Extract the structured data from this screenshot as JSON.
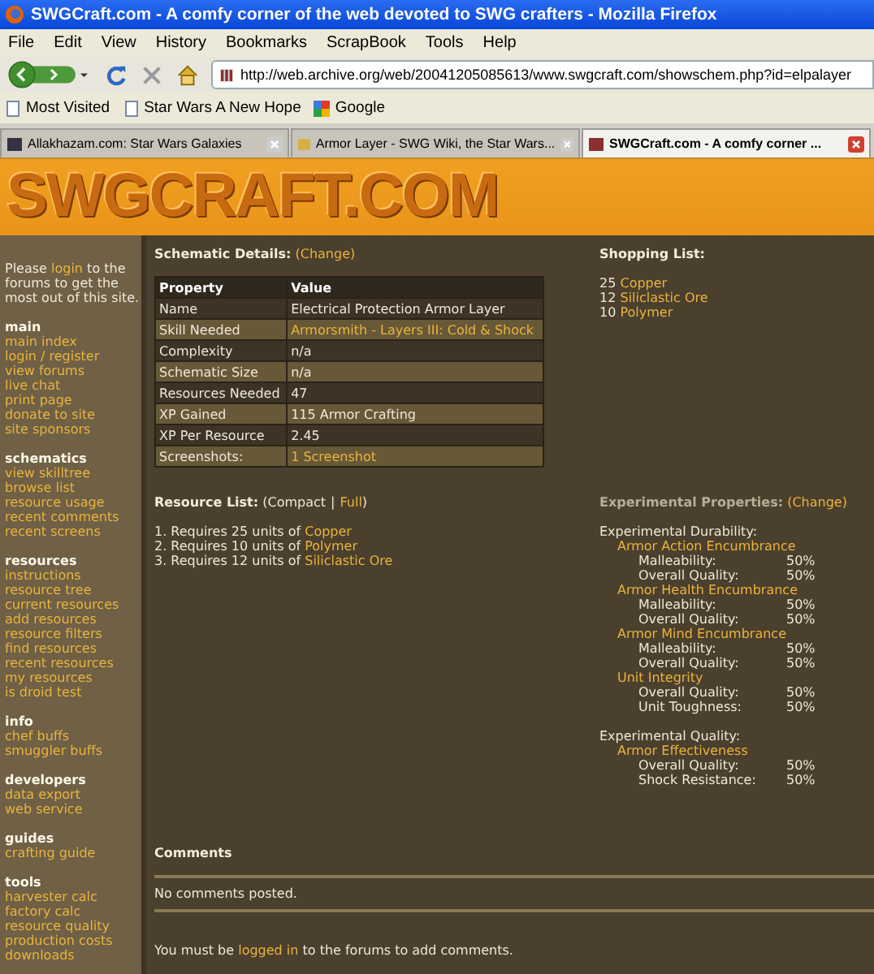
{
  "window": {
    "title": "SWGCraft.com - A comfy corner of the web devoted to SWG crafters - Mozilla Firefox"
  },
  "menu": [
    "File",
    "Edit",
    "View",
    "History",
    "Bookmarks",
    "ScrapBook",
    "Tools",
    "Help"
  ],
  "address": {
    "value": "http://web.archive.org/web/20041205085613/www.swgcraft.com/showschem.php?id=elpalayer"
  },
  "bookmarks": [
    "Most Visited",
    "Star Wars A New Hope",
    "Google"
  ],
  "tabs": [
    {
      "label": "Allakhazam.com: Star Wars Galaxies",
      "selected": false
    },
    {
      "label": "Armor Layer - SWG Wiki, the Star Wars...",
      "selected": false
    },
    {
      "label": "SWGCraft.com - A comfy corner ...",
      "selected": true
    }
  ],
  "logo": "SWGCRAFT.COM",
  "sidebar": {
    "intro": {
      "before": "Please ",
      "link": "login",
      "after": " to the forums to get the most out of this site."
    },
    "sections": [
      {
        "title": "main",
        "items": [
          "main index",
          "login / register",
          "view forums",
          "live chat",
          "print page",
          "donate to site",
          "site sponsors"
        ]
      },
      {
        "title": "schematics",
        "items": [
          "view skilltree",
          "browse list",
          "resource usage",
          "recent comments",
          "recent screens"
        ]
      },
      {
        "title": "resources",
        "items": [
          "instructions",
          "resource tree",
          "current resources",
          "add resources",
          "resource filters",
          "find resources",
          "recent resources",
          "my resources",
          "is droid test"
        ]
      },
      {
        "title": "info",
        "items": [
          "chef buffs",
          "smuggler buffs"
        ]
      },
      {
        "title": "developers",
        "items": [
          "data export",
          "web service"
        ]
      },
      {
        "title": "guides",
        "items": [
          "crafting guide"
        ]
      },
      {
        "title": "tools",
        "items": [
          "harvester calc",
          "factory calc",
          "resource quality",
          "production costs",
          "downloads"
        ]
      }
    ]
  },
  "schematic": {
    "heading": "Schematic Details:",
    "change": "(Change)",
    "columns": [
      "Property",
      "Value"
    ],
    "rows": [
      {
        "property": "Name",
        "value": "Electrical Protection Armor Layer",
        "kind": "text"
      },
      {
        "property": "Skill Needed",
        "value": "Armorsmith - Layers III: Cold & Shock",
        "kind": "link"
      },
      {
        "property": "Complexity",
        "value": "n/a",
        "kind": "text"
      },
      {
        "property": "Schematic Size",
        "value": "n/a",
        "kind": "text"
      },
      {
        "property": "Resources Needed",
        "value": "47",
        "kind": "text"
      },
      {
        "property": "XP Gained",
        "value": "115 Armor Crafting",
        "kind": "text"
      },
      {
        "property": "XP Per Resource",
        "value": "2.45",
        "kind": "text"
      },
      {
        "property": "Screenshots:",
        "value": "1 Screenshot",
        "kind": "link"
      }
    ]
  },
  "shopping": {
    "heading": "Shopping List:",
    "items": [
      {
        "qty": "25",
        "name": "Copper"
      },
      {
        "qty": "12",
        "name": "Siliclastic Ore"
      },
      {
        "qty": "10",
        "name": "Polymer"
      }
    ]
  },
  "resource_list": {
    "heading": "Resource List:",
    "open": "(",
    "separator": "|",
    "close": ")",
    "views": [
      {
        "label": "Compact",
        "selected": true
      },
      {
        "label": "Full",
        "selected": false
      }
    ],
    "items": [
      {
        "text": "1. Requires 25 units of",
        "link": "Copper"
      },
      {
        "text": "2. Requires 10 units of",
        "link": "Polymer"
      },
      {
        "text": "3. Requires 12 units of",
        "link": "Siliclastic Ore"
      }
    ]
  },
  "experimental": {
    "heading": "Experimental Properties:",
    "change": "(Change)",
    "groups": [
      {
        "title": "Experimental Durability:",
        "properties": [
          {
            "name": "Armor Action Encumbrance",
            "stats": [
              {
                "label": "Malleability:",
                "value": "50%"
              },
              {
                "label": "Overall Quality:",
                "value": "50%"
              }
            ]
          },
          {
            "name": "Armor Health Encumbrance",
            "stats": [
              {
                "label": "Malleability:",
                "value": "50%"
              },
              {
                "label": "Overall Quality:",
                "value": "50%"
              }
            ]
          },
          {
            "name": "Armor Mind Encumbrance",
            "stats": [
              {
                "label": "Malleability:",
                "value": "50%"
              },
              {
                "label": "Overall Quality:",
                "value": "50%"
              }
            ]
          },
          {
            "name": "Unit Integrity",
            "stats": [
              {
                "label": "Overall Quality:",
                "value": "50%"
              },
              {
                "label": "Unit Toughness:",
                "value": "50%"
              }
            ]
          }
        ]
      },
      {
        "title": "Experimental Quality:",
        "properties": [
          {
            "name": "Armor Effectiveness",
            "stats": [
              {
                "label": "Overall Quality:",
                "value": "50%"
              },
              {
                "label": "Shock Resistance:",
                "value": "50%"
              }
            ]
          }
        ]
      }
    ]
  },
  "comments": {
    "heading": "Comments",
    "empty": "No comments posted.",
    "note": {
      "before": "You must be ",
      "link": "logged in",
      "after": " to the forums to add comments."
    }
  }
}
